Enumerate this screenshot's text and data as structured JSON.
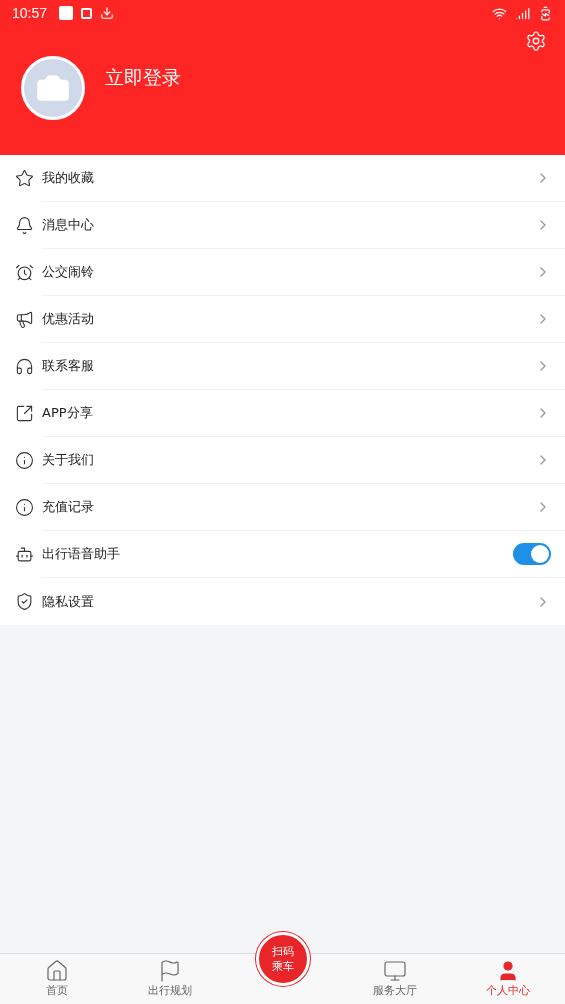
{
  "status_bar": {
    "time": "10:57"
  },
  "profile": {
    "login_label": "立即登录"
  },
  "menu": [
    {
      "label": "我的收藏",
      "kind": "link"
    },
    {
      "label": "消息中心",
      "kind": "link"
    },
    {
      "label": "公交闹铃",
      "kind": "link"
    },
    {
      "label": "优惠活动",
      "kind": "link"
    },
    {
      "label": "联系客服",
      "kind": "link"
    },
    {
      "label": "APP分享",
      "kind": "link"
    },
    {
      "label": "关于我们",
      "kind": "link"
    },
    {
      "label": "充值记录",
      "kind": "link"
    },
    {
      "label": "出行语音助手",
      "kind": "toggle",
      "on": true
    },
    {
      "label": "隐私设置",
      "kind": "link"
    }
  ],
  "bottom_nav": {
    "tabs": [
      {
        "label": "首页",
        "selected": false
      },
      {
        "label": "出行规划",
        "selected": false
      },
      {
        "label": "服务大厅",
        "selected": false
      },
      {
        "label": "个人中心",
        "selected": true
      }
    ],
    "scan_button": [
      "扫码",
      "乘车"
    ]
  }
}
